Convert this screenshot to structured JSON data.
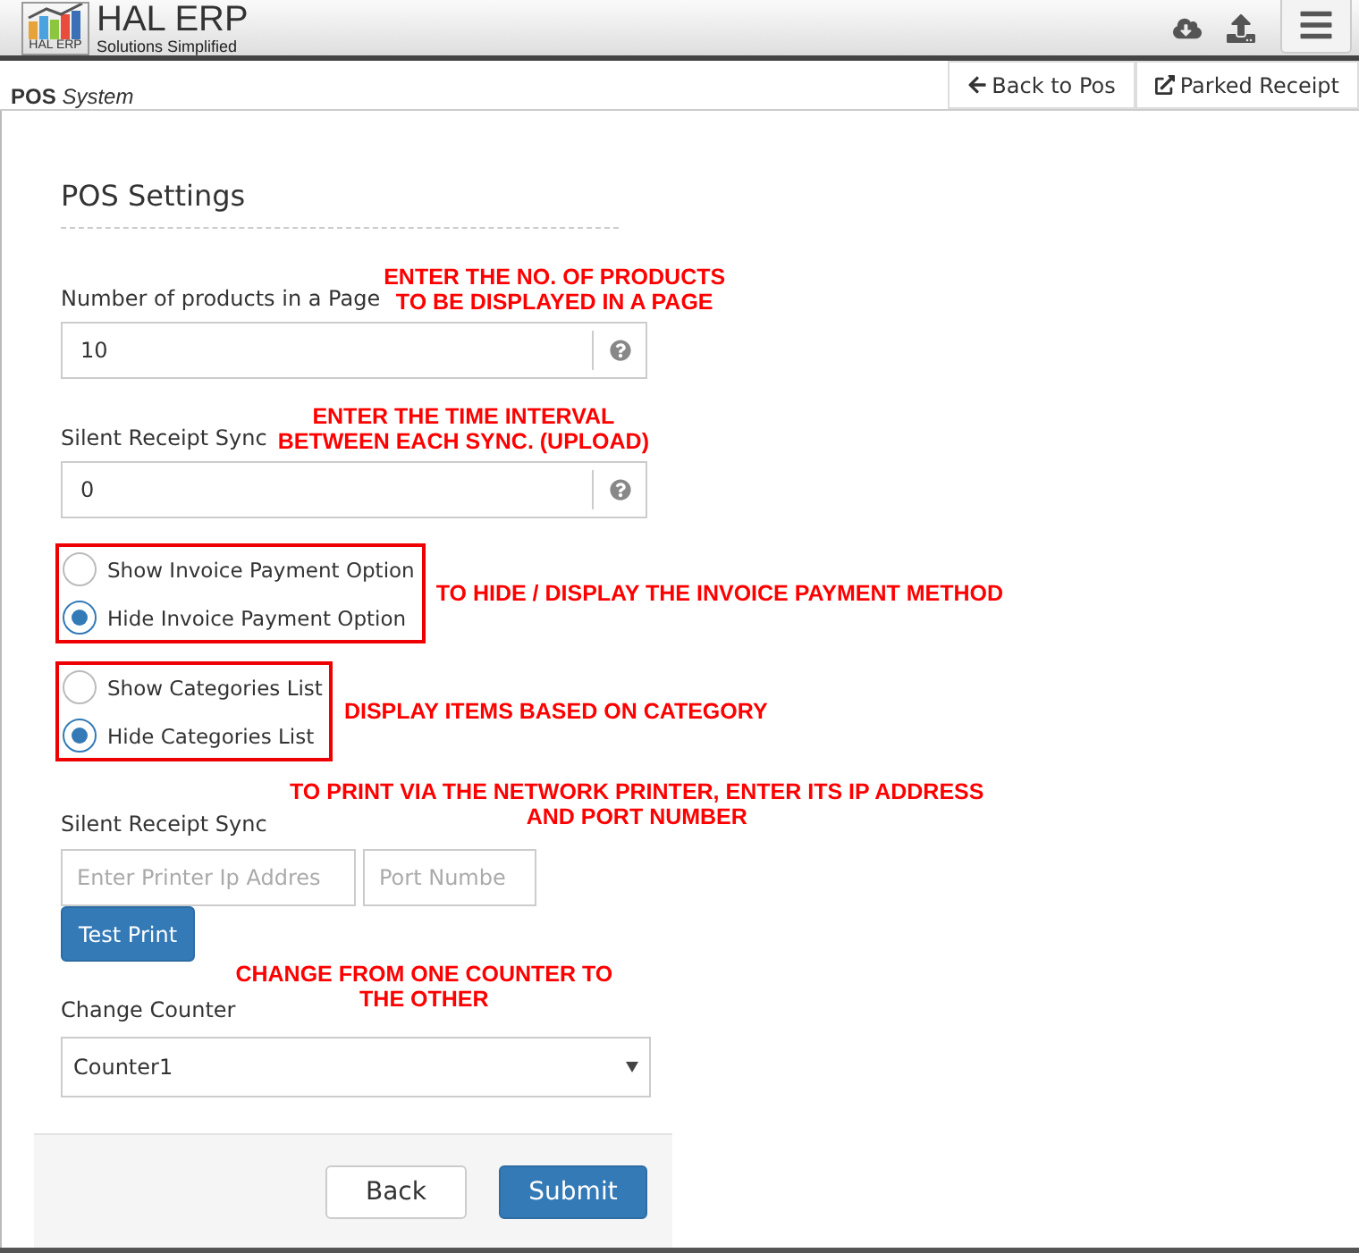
{
  "header": {
    "logo_title": "HAL ERP",
    "logo_badge": "HAL ERP",
    "logo_tagline": "Solutions Simplified"
  },
  "subheader": {
    "title": "POS",
    "subtitle": "System",
    "buttons": [
      {
        "label": "Back to Pos"
      },
      {
        "label": "Parked Receipt"
      }
    ]
  },
  "settings": {
    "title": "POS Settings",
    "sections": [
      {
        "kind": "number",
        "label": "Number of products in a Page",
        "value": "10",
        "note": [
          "ENTER THE NO. OF PRODUCTS",
          "TO BE DISPLAYED IN A PAGE"
        ]
      },
      {
        "kind": "number",
        "label": "Silent Receipt Sync",
        "value": "0",
        "note": [
          "ENTER THE TIME INTERVAL",
          "BETWEEN EACH SYNC. (UPLOAD)"
        ]
      },
      {
        "kind": "radio",
        "options": [
          {
            "label": "Show Invoice Payment Option",
            "selected": false
          },
          {
            "label": "Hide Invoice Payment Option",
            "selected": true
          }
        ],
        "note": [
          "TO HIDE / DISPLAY THE INVOICE PAYMENT METHOD"
        ]
      },
      {
        "kind": "radio",
        "options": [
          {
            "label": "Show Categories List",
            "selected": false
          },
          {
            "label": "Hide Categories List",
            "selected": true
          }
        ],
        "note": [
          "DISPLAY ITEMS BASED ON CATEGORY"
        ]
      },
      {
        "kind": "printer",
        "label": "Silent Receipt Sync",
        "ip_placeholder": "Enter Printer Ip Addres",
        "port_placeholder": "Port Numbe",
        "button": "Test Print",
        "note": [
          "TO PRINT VIA THE NETWORK PRINTER, ENTER ITS IP ADDRESS",
          "AND PORT NUMBER"
        ]
      },
      {
        "kind": "select",
        "label": "Change Counter",
        "value": "Counter1",
        "note": [
          "CHANGE FROM ONE COUNTER TO",
          "THE OTHER"
        ]
      }
    ],
    "actions": [
      {
        "label": "Back",
        "kind": "default"
      },
      {
        "label": "Submit",
        "kind": "primary"
      }
    ]
  }
}
